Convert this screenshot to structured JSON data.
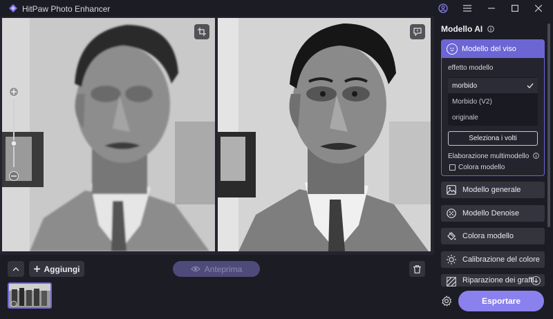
{
  "app": {
    "title": "HitPaw Photo Enhancer",
    "accent": "#7a70e8"
  },
  "window_controls": {
    "account_icon": "user-circle-icon",
    "menu_icon": "menu-icon",
    "minimize_icon": "minimize-icon",
    "maximize_icon": "maximize-icon",
    "close_icon": "close-icon"
  },
  "viewer": {
    "crop_icon": "crop-icon",
    "compare_icon": "comment-icon",
    "zoom_in_icon": "plus-icon",
    "zoom_out_icon": "minus-icon",
    "zoom_level": 0.35
  },
  "bottom_bar": {
    "collapse_icon": "chevron-up-icon",
    "add_label": "Aggiungi",
    "preview_label": "Anteprima",
    "delete_icon": "trash-icon"
  },
  "panel": {
    "title": "Modello AI",
    "face_model": {
      "label": "Modello del viso",
      "effect_label": "effetto modello",
      "options": [
        {
          "label": "morbido",
          "selected": true
        },
        {
          "label": "Morbido (V2)",
          "selected": false
        },
        {
          "label": "originale",
          "selected": false
        }
      ],
      "select_faces_label": "Seleziona i volti",
      "multimodel_label": "Elaborazione multimodello",
      "colorize_checkbox_label": "Colora modello"
    },
    "models": [
      {
        "label": "Modello generale",
        "icon": "image-icon"
      },
      {
        "label": "Modello Denoise",
        "icon": "denoise-icon"
      },
      {
        "label": "Colora modello",
        "icon": "paint-bucket-icon"
      },
      {
        "label": "Calibrazione del colore",
        "icon": "sun-icon"
      },
      {
        "label": "Riparazione dei graffi",
        "icon": "scratch-repair-icon"
      }
    ],
    "export_label": "Esportare"
  }
}
